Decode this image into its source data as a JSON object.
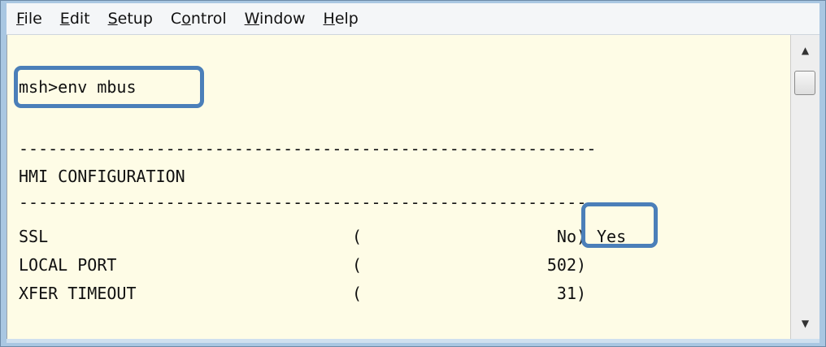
{
  "menu": [
    {
      "pre": "",
      "acc": "F",
      "post": "ile"
    },
    {
      "pre": "",
      "acc": "E",
      "post": "dit"
    },
    {
      "pre": "",
      "acc": "S",
      "post": "etup"
    },
    {
      "pre": "C",
      "acc": "o",
      "post": "ntrol"
    },
    {
      "pre": "",
      "acc": "W",
      "post": "indow"
    },
    {
      "pre": "",
      "acc": "H",
      "post": "elp"
    }
  ],
  "terminal": {
    "command": "msh>env mbus",
    "separator": "-----------------------------------------------------------",
    "section_title": "HMI CONFIGURATION",
    "rows": [
      {
        "name": "SSL",
        "open": "(",
        "value": "No",
        "close": ")"
      },
      {
        "name": "LOCAL PORT",
        "open": "(",
        "value": "502",
        "close": ")"
      },
      {
        "name": "XFER TIMEOUT",
        "open": "(",
        "value": "31",
        "close": ")"
      }
    ],
    "annotation": "Yes"
  },
  "scrollbar": {
    "up_arrow_icon": "triangle-up-icon",
    "down_arrow_icon": "triangle-down-icon"
  },
  "colors": {
    "terminal_bg": "#fefce6",
    "highlight_border": "#4b7fb9",
    "window_frame": "#a9c7e2"
  }
}
